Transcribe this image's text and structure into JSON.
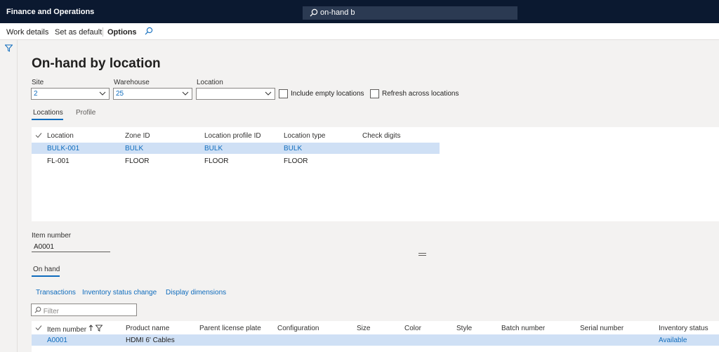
{
  "app": {
    "title": "Finance and Operations",
    "search_value": "on-hand b"
  },
  "actions": {
    "work_details": "Work details",
    "set_default": "Set as default",
    "options": "Options"
  },
  "page": {
    "title": "On-hand by location"
  },
  "filters": {
    "site_label": "Site",
    "site_value": "2",
    "warehouse_label": "Warehouse",
    "warehouse_value": "25",
    "location_label": "Location",
    "location_value": "",
    "include_empty": "Include empty locations",
    "refresh_across": "Refresh across locations"
  },
  "tabs": {
    "locations": "Locations",
    "profile": "Profile"
  },
  "locations_grid": {
    "headers": [
      "Location",
      "Zone ID",
      "Location profile ID",
      "Location type",
      "Check digits"
    ],
    "rows": [
      [
        "BULK-001",
        "BULK",
        "BULK",
        "BULK",
        ""
      ],
      [
        "FL-001",
        "FLOOR",
        "FLOOR",
        "FLOOR",
        ""
      ]
    ]
  },
  "item": {
    "label": "Item number",
    "value": "A0001"
  },
  "onhand": {
    "tab": "On hand",
    "actions": [
      "Transactions",
      "Inventory status change",
      "Display dimensions"
    ],
    "filter_placeholder": "Filter",
    "headers": [
      "Item number",
      "Product name",
      "Parent license plate",
      "Configuration",
      "Size",
      "Color",
      "Style",
      "Batch number",
      "Serial number",
      "Inventory status"
    ],
    "rows": [
      [
        "A0001",
        "HDMI 6' Cables",
        "",
        "",
        "",
        "",
        "",
        "",
        "",
        "Available"
      ]
    ]
  },
  "colors": {
    "topbar": "#0b1930",
    "accent": "#0f6cbd",
    "selected_row": "#cfe0f5"
  },
  "icons": [
    "search-icon",
    "filter-icon",
    "chevron-down-icon",
    "checkmark-icon",
    "sort-ascending-icon"
  ]
}
